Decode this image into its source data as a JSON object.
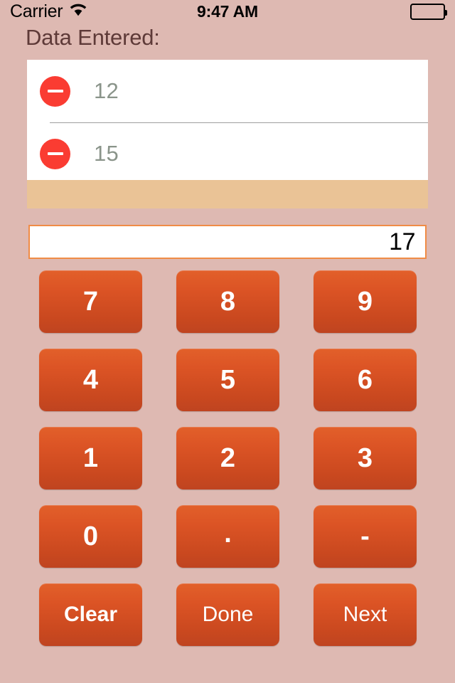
{
  "statusbar": {
    "carrier": "Carrier",
    "wifi_icon": "wifi-icon",
    "time": "9:47 AM",
    "battery_icon": "battery-full-icon"
  },
  "header": {
    "title": "Data Entered:"
  },
  "list": {
    "rows": [
      {
        "value": "12",
        "delete_icon": "minus-circle-icon"
      },
      {
        "value": "15",
        "delete_icon": "minus-circle-icon"
      }
    ]
  },
  "input": {
    "value": "17",
    "placeholder": ""
  },
  "keypad": {
    "keys": [
      {
        "label": "7",
        "name": "key-7",
        "kind": "digit"
      },
      {
        "label": "8",
        "name": "key-8",
        "kind": "digit"
      },
      {
        "label": "9",
        "name": "key-9",
        "kind": "digit"
      },
      {
        "label": "4",
        "name": "key-4",
        "kind": "digit"
      },
      {
        "label": "5",
        "name": "key-5",
        "kind": "digit"
      },
      {
        "label": "6",
        "name": "key-6",
        "kind": "digit"
      },
      {
        "label": "1",
        "name": "key-1",
        "kind": "digit"
      },
      {
        "label": "2",
        "name": "key-2",
        "kind": "digit"
      },
      {
        "label": "3",
        "name": "key-3",
        "kind": "digit"
      },
      {
        "label": "0",
        "name": "key-0",
        "kind": "digit"
      },
      {
        "label": ".",
        "name": "key-decimal",
        "kind": "dot"
      },
      {
        "label": "-",
        "name": "key-minus",
        "kind": "minus"
      },
      {
        "label": "Clear",
        "name": "key-clear",
        "kind": "action-bold"
      },
      {
        "label": "Done",
        "name": "key-done",
        "kind": "action"
      },
      {
        "label": "Next",
        "name": "key-next",
        "kind": "action"
      }
    ]
  },
  "colors": {
    "background": "#deb9b2",
    "title_text": "#5e3a38",
    "list_background": "#ffffff",
    "list_value_text": "#8a948a",
    "list_footer": "#eac396",
    "delete_red": "#fa3c32",
    "input_border": "#f08c46",
    "key_gradient_top": "#e2602a",
    "key_gradient_bottom": "#bf4420",
    "key_text": "#ffffff"
  }
}
